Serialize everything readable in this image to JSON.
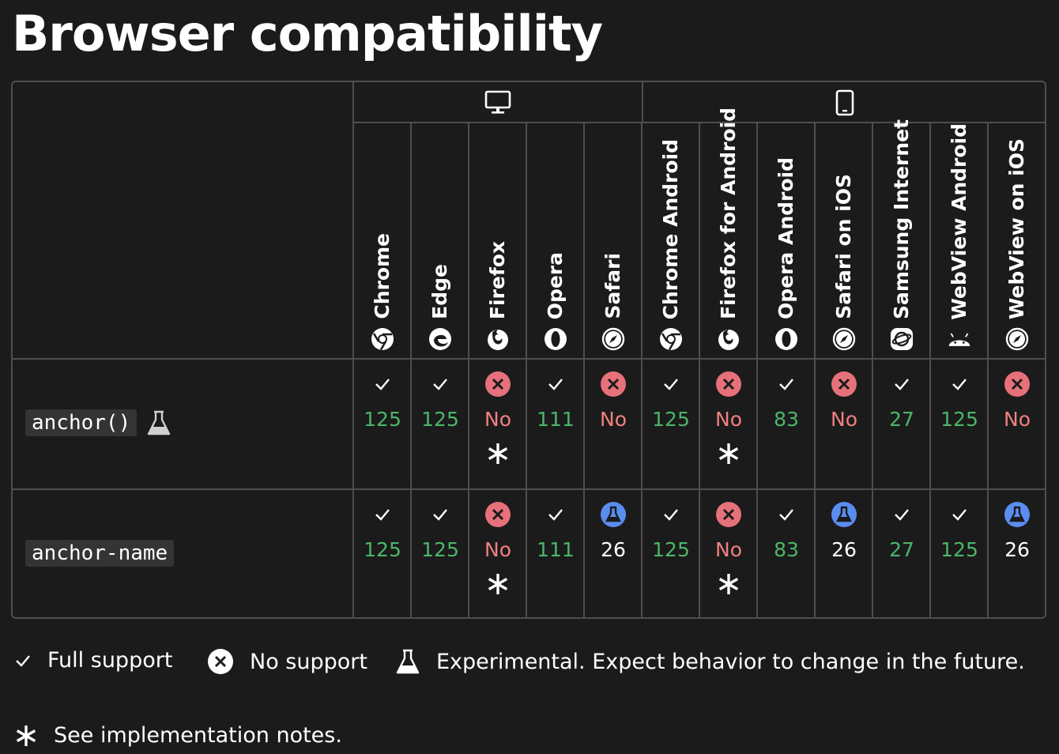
{
  "title": "Browser compatibility",
  "colors": {
    "background": "#1b1b1b",
    "border": "#4e4e4e",
    "supported": "#4cb56a",
    "unsupported": "#f08080",
    "no_icon_bg": "#e6717a",
    "experimental_icon_bg": "#5a8df0",
    "code_bg": "#343434"
  },
  "groups": [
    {
      "icon": "desktop-icon"
    },
    {
      "icon": "mobile-icon"
    }
  ],
  "browsers": [
    {
      "name": "Chrome",
      "icon": "chrome-icon"
    },
    {
      "name": "Edge",
      "icon": "edge-icon"
    },
    {
      "name": "Firefox",
      "icon": "firefox-icon"
    },
    {
      "name": "Opera",
      "icon": "opera-icon"
    },
    {
      "name": "Safari",
      "icon": "safari-icon"
    },
    {
      "name": "Chrome Android",
      "icon": "chrome-icon"
    },
    {
      "name": "Firefox for Android",
      "icon": "firefox-icon"
    },
    {
      "name": "Opera Android",
      "icon": "opera-icon"
    },
    {
      "name": "Safari on iOS",
      "icon": "safari-icon"
    },
    {
      "name": "Samsung Internet",
      "icon": "samsung-internet-icon"
    },
    {
      "name": "WebView Android",
      "icon": "android-icon"
    },
    {
      "name": "WebView on iOS",
      "icon": "safari-icon"
    }
  ],
  "features": [
    {
      "name": "anchor()",
      "experimental": true,
      "cells": [
        {
          "status": "yes",
          "version": "125"
        },
        {
          "status": "yes",
          "version": "125"
        },
        {
          "status": "no",
          "version": "No",
          "note": true
        },
        {
          "status": "yes",
          "version": "111"
        },
        {
          "status": "no",
          "version": "No"
        },
        {
          "status": "yes",
          "version": "125"
        },
        {
          "status": "no",
          "version": "No",
          "note": true
        },
        {
          "status": "yes",
          "version": "83"
        },
        {
          "status": "no",
          "version": "No"
        },
        {
          "status": "yes",
          "version": "27"
        },
        {
          "status": "yes",
          "version": "125"
        },
        {
          "status": "no",
          "version": "No"
        }
      ]
    },
    {
      "name": "anchor-name",
      "experimental": false,
      "cells": [
        {
          "status": "yes",
          "version": "125"
        },
        {
          "status": "yes",
          "version": "125"
        },
        {
          "status": "no",
          "version": "No",
          "note": true
        },
        {
          "status": "yes",
          "version": "111"
        },
        {
          "status": "experimental",
          "version": "26"
        },
        {
          "status": "yes",
          "version": "125"
        },
        {
          "status": "no",
          "version": "No",
          "note": true
        },
        {
          "status": "yes",
          "version": "83"
        },
        {
          "status": "experimental",
          "version": "26"
        },
        {
          "status": "yes",
          "version": "27"
        },
        {
          "status": "yes",
          "version": "125"
        },
        {
          "status": "experimental",
          "version": "26"
        }
      ]
    }
  ],
  "legend": [
    {
      "icon": "check-icon",
      "label": "Full support"
    },
    {
      "icon": "no-support-icon",
      "label": "No support"
    },
    {
      "icon": "flask-icon",
      "label": "Experimental. Expect behavior to change in the future."
    },
    {
      "icon": "asterisk-icon",
      "label": "See implementation notes."
    }
  ]
}
